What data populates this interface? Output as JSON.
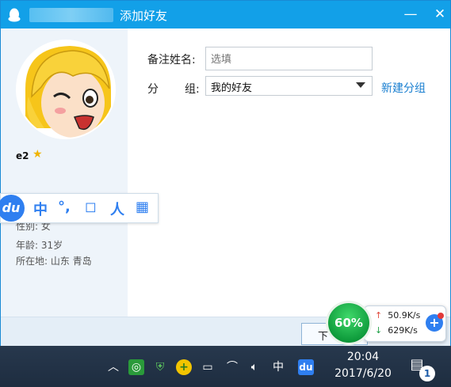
{
  "window": {
    "title": "添加好友",
    "min_glyph": "—",
    "close_glyph": "✕",
    "accent": "#12a0e8"
  },
  "profile": {
    "nickname": "e2",
    "gender": "性别: 女",
    "age": "年龄: 31岁",
    "location": "所在地: 山东  青岛"
  },
  "ime": {
    "logo": "du",
    "buttons": [
      "中",
      "°,",
      "◻",
      "人",
      "▦"
    ]
  },
  "form": {
    "remark_label": "备注姓名:",
    "remark_placeholder": "选填",
    "group_label_1": "分",
    "group_label_2": "组:",
    "group_value": "我的好友",
    "new_group_link": "新建分组"
  },
  "footer": {
    "next_label": "下"
  },
  "speed_widget": {
    "percent": "60%",
    "upload": "50.9K/s",
    "download": "629K/s"
  },
  "taskbar": {
    "ime_label": "中",
    "baidu_label": "du",
    "time": "20:04",
    "date": "2017/6/20",
    "notification_count": "1"
  }
}
